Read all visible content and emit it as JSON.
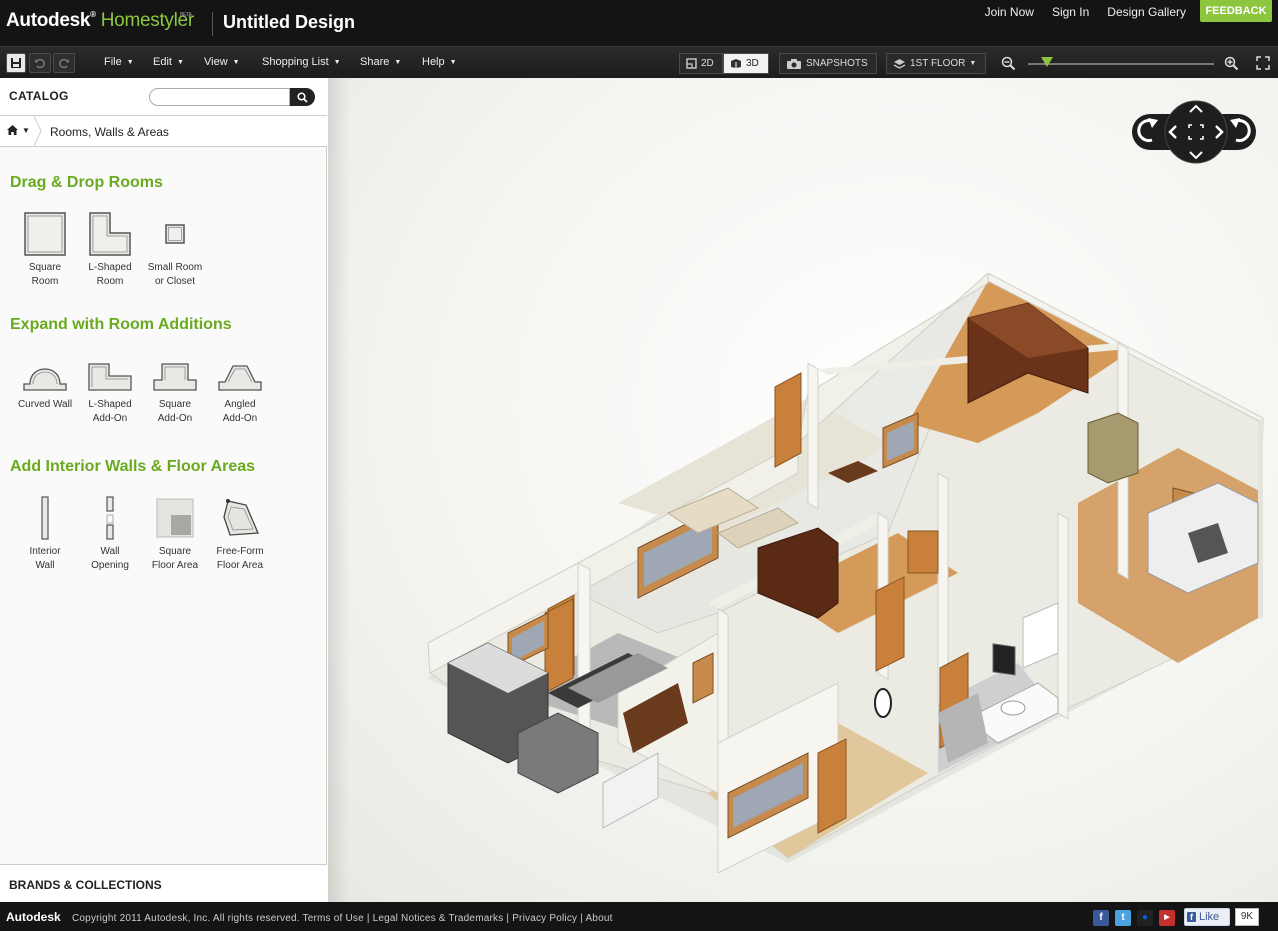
{
  "header": {
    "brand_prefix": "Autodesk",
    "brand_product": "Homestyler",
    "brand_tag": "BETA",
    "design_title": "Untitled Design",
    "links": [
      "Join Now",
      "Sign In",
      "Design Gallery"
    ],
    "feedback_label": "FEEDBACK"
  },
  "toolbar": {
    "menus": [
      "File",
      "Edit",
      "View",
      "Shopping List",
      "Share",
      "Help"
    ],
    "view_2d_label": "2D",
    "view_3d_label": "3D",
    "active_view": "3D",
    "snapshots_label": "SNAPSHOTS",
    "floor_label": "1ST FLOOR",
    "zoom_level": 0.1
  },
  "sidebar": {
    "catalog_label": "CATALOG",
    "search_placeholder": "",
    "breadcrumb": "Rooms, Walls & Areas",
    "sections": [
      {
        "title": "Drag & Drop Rooms",
        "items": [
          {
            "label1": "Square",
            "label2": "Room",
            "icon": "square-room-icon"
          },
          {
            "label1": "L-Shaped",
            "label2": "Room",
            "icon": "l-shaped-room-icon"
          },
          {
            "label1": "Small Room",
            "label2": "or Closet",
            "icon": "small-room-icon"
          }
        ]
      },
      {
        "title": "Expand with Room Additions",
        "items": [
          {
            "label1": "Curved Wall",
            "label2": "",
            "icon": "curved-wall-icon"
          },
          {
            "label1": "L-Shaped",
            "label2": "Add-On",
            "icon": "l-shaped-addon-icon"
          },
          {
            "label1": "Square",
            "label2": "Add-On",
            "icon": "square-addon-icon"
          },
          {
            "label1": "Angled",
            "label2": "Add-On",
            "icon": "angled-addon-icon"
          }
        ]
      },
      {
        "title": "Add Interior Walls & Floor Areas",
        "items": [
          {
            "label1": "Interior",
            "label2": "Wall",
            "icon": "interior-wall-icon"
          },
          {
            "label1": "Wall",
            "label2": "Opening",
            "icon": "wall-opening-icon"
          },
          {
            "label1": "Square",
            "label2": "Floor Area",
            "icon": "square-floor-area-icon"
          },
          {
            "label1": "Free-Form",
            "label2": "Floor Area",
            "icon": "freeform-floor-area-icon"
          }
        ]
      }
    ],
    "brands_label": "BRANDS & COLLECTIONS"
  },
  "footer": {
    "brand": "Autodesk",
    "copyright": "Copyright 2011 Autodesk, Inc. All rights reserved.",
    "links": [
      "Terms of Use",
      "Legal Notices & Trademarks",
      "Privacy Policy",
      "About"
    ],
    "like_label": "Like",
    "like_count": "9K"
  },
  "colors": {
    "accent_green": "#8cc63f",
    "section_green": "#6aaa1e",
    "bar_dark": "#141414"
  }
}
